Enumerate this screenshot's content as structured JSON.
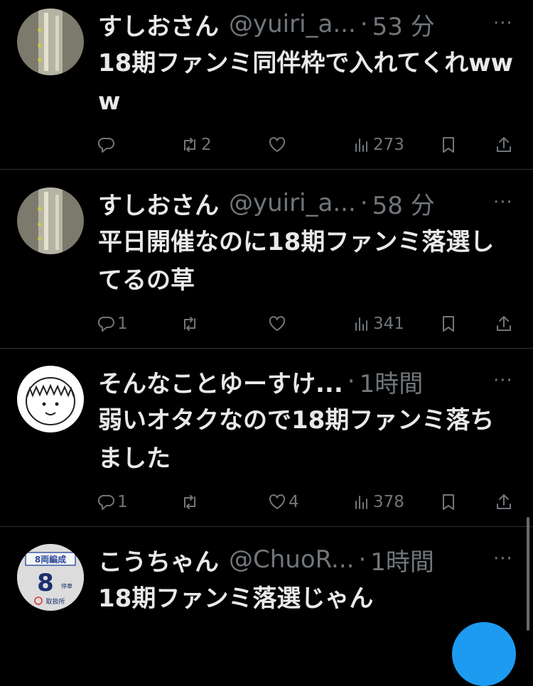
{
  "tweets": [
    {
      "name": "すしおさん",
      "handle": "@yuiri_a...",
      "time": "53 分",
      "text": "18期ファンミ同伴枠で入れてくれwww",
      "replies": "",
      "retweets": "2",
      "likes": "",
      "views": "273",
      "avatar": "photo"
    },
    {
      "name": "すしおさん",
      "handle": "@yuiri_a...",
      "time": "58 分",
      "text": "平日開催なのに18期ファンミ落選してるの草",
      "replies": "1",
      "retweets": "",
      "likes": "",
      "views": "341",
      "avatar": "photo"
    },
    {
      "name": "そんなことゆーすけ...",
      "handle": "",
      "time": "1時間",
      "text": "弱いオタクなので18期ファンミ落ちました",
      "replies": "1",
      "retweets": "",
      "likes": "4",
      "views": "378",
      "avatar": "drawn-face"
    },
    {
      "name": "こうちゃん",
      "handle": "@ChuoR...",
      "time": "1時間",
      "text": "18期ファンミ落選じゃん",
      "replies": "",
      "retweets": "",
      "likes": "",
      "views": "",
      "avatar": "train-sign",
      "avatar_text": {
        "top": "8両編成",
        "number": "8",
        "small": "停車",
        "bottom": "取扱所"
      }
    }
  ],
  "more_glyph": "···",
  "dot": "·",
  "colors": {
    "background": "#000000",
    "text": "#e7e9ea",
    "muted": "#71767b",
    "divider": "#2f3336",
    "accent": "#1d9bf0"
  },
  "icons": [
    "reply-icon",
    "retweet-icon",
    "like-icon",
    "views-icon",
    "bookmark-icon",
    "share-icon",
    "more-icon"
  ]
}
